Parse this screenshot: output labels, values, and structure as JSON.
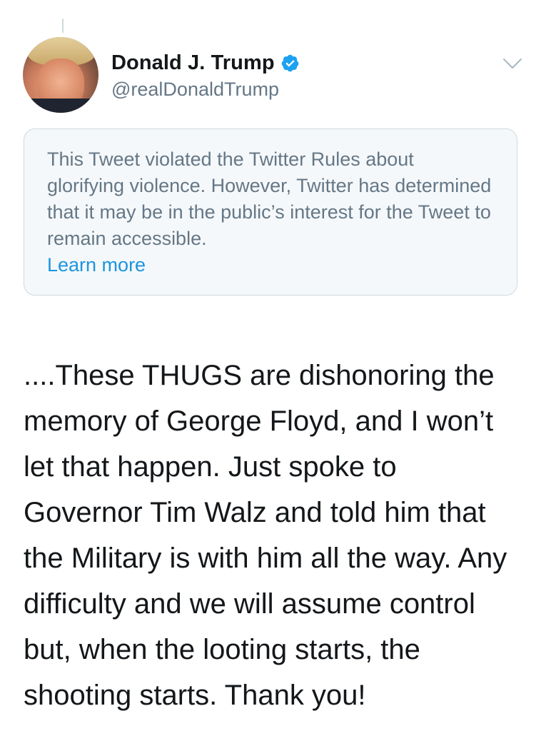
{
  "tweet": {
    "author": {
      "display_name": "Donald J. Trump",
      "handle": "@realDonaldTrump",
      "verified": true,
      "avatar_icon": "avatar-photo"
    },
    "notice": {
      "text": "This Tweet violated the Twitter Rules about glorifying violence. However, Twitter has determined that it may be in the public’s interest for the Tweet to remain accessible.",
      "link_label": "Learn more"
    },
    "body": "....These THUGS are dishonoring the memory of George Floyd, and I won’t let that happen. Just spoke to Governor Tim Walz and told him that the Military is with him all the way. Any difficulty and we will assume control but, when the looting starts, the shooting starts. Thank you!",
    "icons": {
      "verified": "verified-badge-icon",
      "menu": "chevron-down-icon"
    }
  },
  "colors": {
    "verified_blue": "#1da1f2",
    "link_blue": "#1b95e0",
    "secondary_text": "#657786",
    "notice_bg": "#f5f8fa",
    "border": "#cfd9de"
  }
}
